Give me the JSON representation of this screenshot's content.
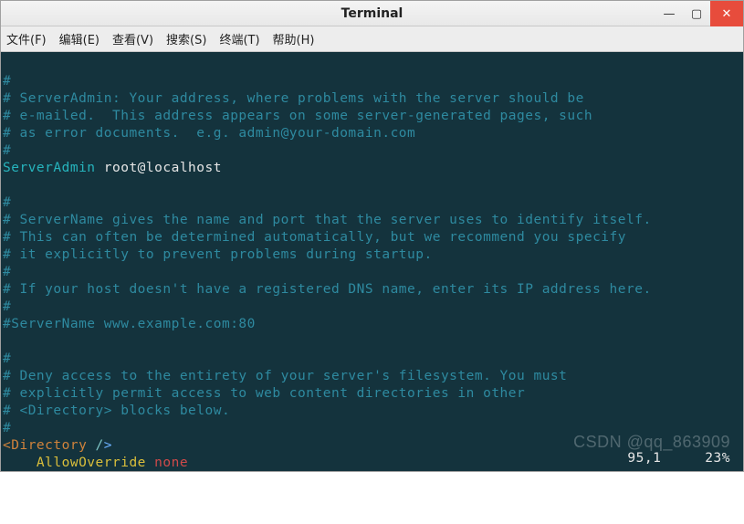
{
  "window": {
    "title": "Terminal",
    "controls": {
      "min": "—",
      "max": "▢",
      "close": "✕"
    }
  },
  "menu": {
    "file": "文件(F)",
    "edit": "编辑(E)",
    "view": "查看(V)",
    "search": "搜索(S)",
    "terminal": "终端(T)",
    "help": "帮助(H)"
  },
  "lines": {
    "l1": "#",
    "l2": "# ServerAdmin: Your address, where problems with the server should be",
    "l3": "# e-mailed.  This address appears on some server-generated pages, such",
    "l4": "# as error documents.  e.g. admin@your-domain.com",
    "l5": "#",
    "l6a": "ServerAdmin",
    "l6b": " root@localhost",
    "l7": "",
    "l8": "#",
    "l9": "# ServerName gives the name and port that the server uses to identify itself.",
    "l10": "# This can often be determined automatically, but we recommend you specify",
    "l11": "# it explicitly to prevent problems during startup.",
    "l12": "#",
    "l13": "# If your host doesn't have a registered DNS name, enter its IP address here.",
    "l14": "#",
    "l15": "#ServerName www.example.com:80",
    "l16": "",
    "l17": "#",
    "l18": "# Deny access to the entirety of your server's filesystem. You must",
    "l19": "# explicitly permit access to web content directories in other",
    "l20": "# <Directory> blocks below.",
    "l21": "#",
    "l22a": "<Directory ",
    "l22b": "/",
    "l22c": ">",
    "l23a": "    AllowOverride ",
    "l23b": "none"
  },
  "status": {
    "pos": "95,1",
    "pct": "23%"
  },
  "watermark": "CSDN @qq_863909"
}
